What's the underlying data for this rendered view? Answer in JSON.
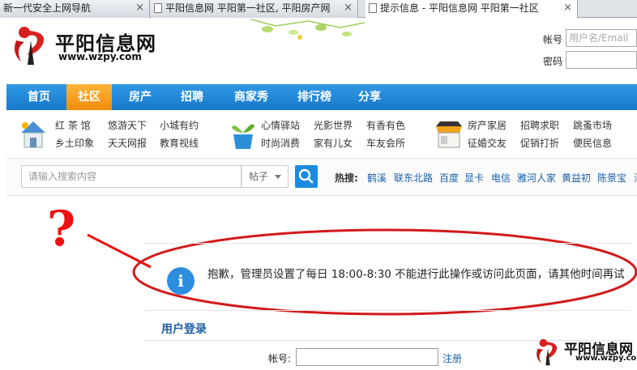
{
  "browser": {
    "tabs": [
      {
        "title": "新一代安全上网导航",
        "close": "×"
      },
      {
        "title": "平阳信息网 平阳第一社区, 平阳房产网",
        "close": "×"
      },
      {
        "title": "提示信息 - 平阳信息网 平阳第一社区",
        "close": "×"
      }
    ]
  },
  "header": {
    "logo_text": "平阳信息网",
    "logo_url": "www.wzpy.com",
    "login": {
      "account_label": "帐号",
      "account_placeholder": "用户名/Email",
      "password_label": "密码"
    }
  },
  "nav": {
    "items": [
      "首页",
      "社区",
      "房产",
      "招聘",
      "商家秀",
      "排行榜",
      "分享"
    ],
    "active": "社区"
  },
  "sublinks": {
    "group1": [
      "红 茶 馆",
      "悠游天下",
      "小城有约",
      "乡土印象",
      "天天网报",
      "教育视线"
    ],
    "group2": [
      "心情驿站",
      "光影世界",
      "有香有色",
      "时尚消费",
      "家有儿女",
      "车友会所"
    ],
    "group3": [
      "房产家居",
      "招聘求职",
      "跳蚤市场",
      "征婚交友",
      "促销打折",
      "便民信息"
    ]
  },
  "search": {
    "placeholder": "请输入搜索内容",
    "type": "帖子",
    "hot_label": "热搜:",
    "hot_words": [
      "鹤溪",
      "联东北路",
      "百度",
      "显卡",
      "电信",
      "雅河人家",
      "黄益初",
      "陈景宝",
      "海"
    ]
  },
  "annotation": {
    "mark": "?"
  },
  "message": {
    "text": "抱歉，管理员设置了每日 18:00-8:30 不能进行此操作或访问此页面，请其他时间再试"
  },
  "login_form": {
    "title": "用户登录",
    "account_label": "帐号:",
    "register_link": "注册"
  },
  "watermark": {
    "text": "平阳信息网",
    "url": "www.wzpy.com"
  },
  "colors": {
    "nav_blue": "#1a88dc",
    "nav_active_orange": "#f59b1d",
    "annotation_red": "#e11111",
    "link_blue": "#1a5fa8"
  }
}
